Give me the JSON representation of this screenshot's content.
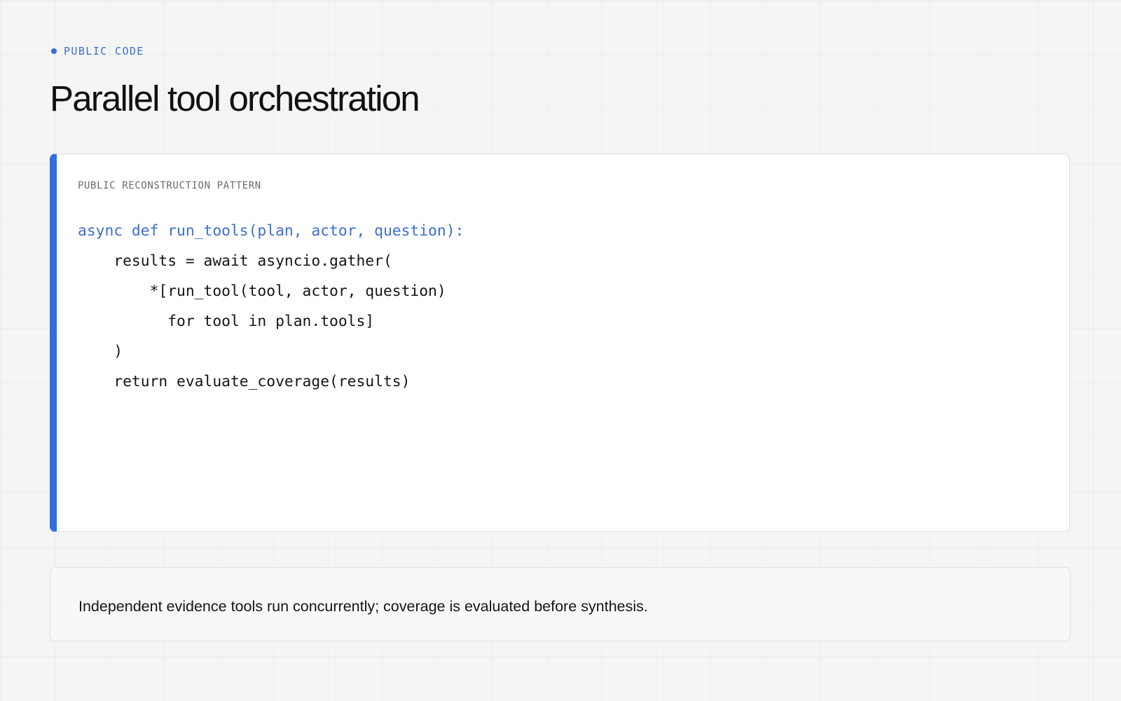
{
  "eyebrow": {
    "label": "PUBLIC CODE"
  },
  "page": {
    "title": "Parallel tool orchestration"
  },
  "code_panel": {
    "label": "PUBLIC RECONSTRUCTION PATTERN",
    "accent_color": "#2f6fde",
    "lines": [
      "async def run_tools(plan, actor, question):",
      "    results = await asyncio.gather(",
      "        *[run_tool(tool, actor, question)",
      "          for tool in plan.tools]",
      "    )",
      "    return evaluate_coverage(results)"
    ]
  },
  "note": {
    "text": "Independent evidence tools run concurrently; coverage is evaluated before synthesis."
  },
  "colors": {
    "background": "#f5f5f3",
    "accent": "#2f6fde",
    "signature_text": "#3a6fd0",
    "body_text": "#111111"
  }
}
